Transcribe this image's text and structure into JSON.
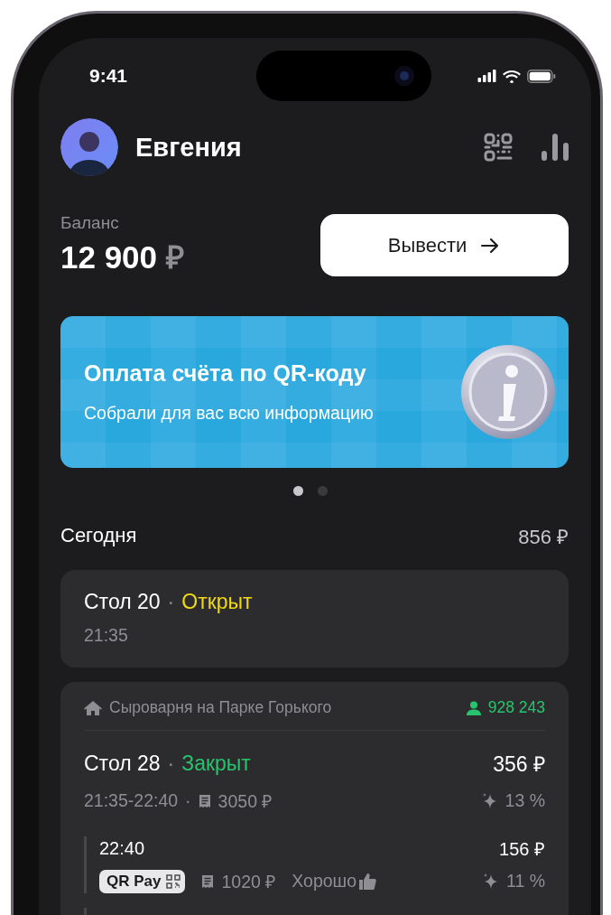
{
  "status_bar": {
    "time": "9:41"
  },
  "header": {
    "name": "Евгения"
  },
  "balance": {
    "label": "Баланс",
    "amount": "12 900",
    "currency": "₽",
    "withdraw_button": "Вывести"
  },
  "banner": {
    "title": "Оплата счёта по QR-коду",
    "subtitle": "Собрали для вас всю информацию"
  },
  "carousel_dots": [
    {
      "selected": true
    },
    {
      "selected": false
    }
  ],
  "today": {
    "label": "Сегодня",
    "total": "856 ₽"
  },
  "orders": [
    {
      "kind": "simple",
      "table": "Стол 20",
      "separator": "·",
      "status": "Открыт",
      "color": "#f0d90f",
      "time": "21:35"
    },
    {
      "kind": "venue",
      "venue": "Сыроварня на Парке Горького",
      "guest_id": "928 243",
      "table": "Стол 28",
      "separator": "·",
      "status": "Закрыт",
      "color": "#27c46e",
      "time": "21:35-22:40",
      "time_separator": "·",
      "check": "3050 ₽",
      "tip": "356 ₽",
      "tip_percent": "13 %",
      "payments": [
        {
          "time": "22:40",
          "method": "QR Pay",
          "check": "1020 ₽",
          "rating": "Хорошо",
          "tip": "156 ₽",
          "tip_percent": "11 %"
        }
      ]
    }
  ]
}
